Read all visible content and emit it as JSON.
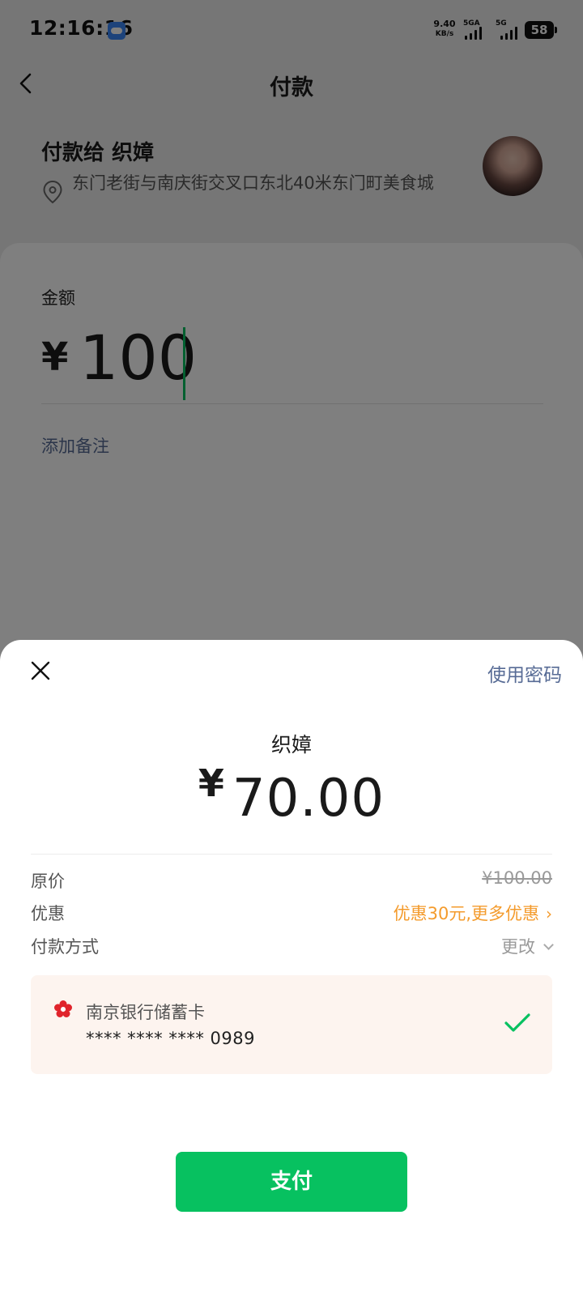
{
  "status_bar": {
    "time": "12:16:16",
    "net_speed_value": "9.40",
    "net_speed_unit": "KB/s",
    "sim1_label": "5GA",
    "sim2_label": "5G",
    "battery": "58",
    "app_icon": "cloud-icon"
  },
  "nav": {
    "back_icon": "chevron-left-icon",
    "title": "付款"
  },
  "payee": {
    "title": "付款给 织嫜",
    "location": "东门老街与南庆街交叉口东北40米东门町美食城",
    "location_icon": "location-pin-icon"
  },
  "amount": {
    "label": "金额",
    "currency": "¥",
    "value": "100",
    "remark_link": "添加备注"
  },
  "sheet": {
    "close_icon": "close-icon",
    "password_link": "使用密码",
    "payee_name": "织嫜",
    "currency": "¥",
    "pay_amount": "70.00",
    "original_price_label": "原价",
    "original_price_value": "¥100.00",
    "discount_label": "优惠",
    "discount_value": "优惠30元,更多优惠",
    "method_label": "付款方式",
    "method_change": "更改",
    "card": {
      "bank_name": "南京银行储蓄卡",
      "card_number": "**** **** **** 0989",
      "selected_icon": "checkmark-icon"
    },
    "pay_button": "支付"
  },
  "colors": {
    "accent_green": "#07c160",
    "link_blue": "#576b95",
    "discount_orange": "#f49b2c",
    "card_background": "#fdf4ef"
  }
}
